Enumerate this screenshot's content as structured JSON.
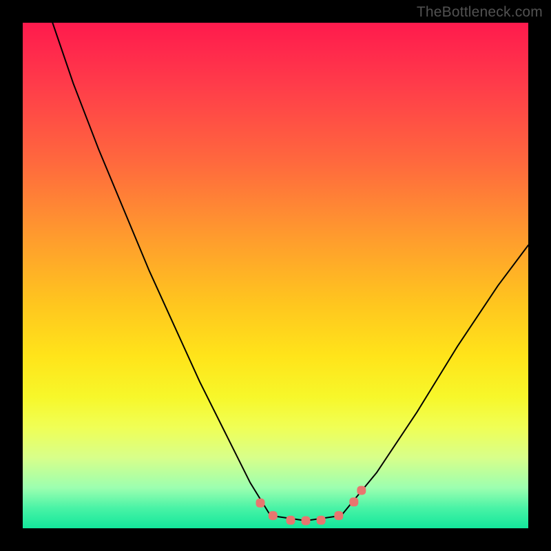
{
  "watermark": "TheBottleneck.com",
  "colors": {
    "background": "#000000",
    "curve": "#000000",
    "marker": "#e8766f",
    "gradient_top": "#ff1a4d",
    "gradient_bottom": "#13e79b"
  },
  "chart_data": {
    "type": "line",
    "title": "",
    "xlabel": "",
    "ylabel": "",
    "xlim": [
      0,
      100
    ],
    "ylim": [
      0,
      100
    ],
    "note": "No axis ticks or numeric labels are rendered in the image; x/y are normalized 0–100. y≈0 is the green bottom (best), y≈100 is the red top (worst). Values are read off the curve geometry.",
    "series": [
      {
        "name": "left-branch",
        "x": [
          5.9,
          10,
          15,
          20,
          25,
          30,
          35,
          40,
          45,
          49
        ],
        "y": [
          100,
          88,
          75,
          63,
          51,
          40,
          29,
          19,
          9,
          2.5
        ]
      },
      {
        "name": "flat-bottom",
        "x": [
          49,
          56,
          63
        ],
        "y": [
          2.5,
          1.5,
          2.5
        ]
      },
      {
        "name": "right-branch",
        "x": [
          63,
          70,
          78,
          86,
          94,
          100
        ],
        "y": [
          2.5,
          11,
          23,
          36,
          48,
          56
        ]
      }
    ],
    "markers": {
      "name": "highlighted-points",
      "shape": "rounded-square",
      "points": [
        {
          "x": 47.0,
          "y": 5.0
        },
        {
          "x": 49.5,
          "y": 2.5
        },
        {
          "x": 53.0,
          "y": 1.6
        },
        {
          "x": 56.0,
          "y": 1.5
        },
        {
          "x": 59.0,
          "y": 1.6
        },
        {
          "x": 62.5,
          "y": 2.5
        },
        {
          "x": 65.5,
          "y": 5.2
        },
        {
          "x": 67.0,
          "y": 7.5
        }
      ]
    }
  }
}
